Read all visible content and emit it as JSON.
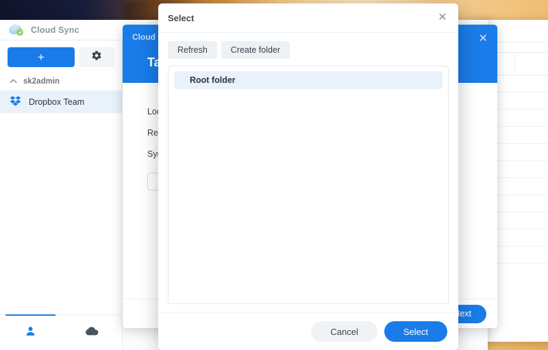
{
  "app": {
    "title": "Cloud Sync",
    "logo_icon": "cloud-sync-logo-icon",
    "sidebar": {
      "add_button_label": "+",
      "add_button_icon": "plus-icon",
      "settings_icon": "gear-icon",
      "group": {
        "label": "sk2admin",
        "collapse_icon": "chevron-up-icon"
      },
      "items": [
        {
          "label": "Dropbox Team",
          "icon": "dropbox-icon"
        }
      ],
      "footer_tabs": [
        {
          "icon": "user-icon",
          "active": true
        },
        {
          "icon": "cloud-icon",
          "active": false
        }
      ]
    }
  },
  "wizard": {
    "window_title": "Cloud Sync",
    "heading": "Task Creation Wizard",
    "close_icon": "close-icon",
    "rows": [
      {
        "label": "Local path:",
        "info_icon": "info-icon"
      },
      {
        "label": "Remote path:",
        "info_icon": "info-icon"
      },
      {
        "label": "Sync direction:",
        "info_icon": ""
      }
    ],
    "footer": {
      "next_label": "Next"
    }
  },
  "bg_window": {
    "restore_icon": "restore-window-icon",
    "close_icon": "close-icon"
  },
  "dialog": {
    "title": "Select",
    "close_icon": "close-icon",
    "toolbar": [
      {
        "label": "Refresh",
        "name": "refresh-button"
      },
      {
        "label": "Create folder",
        "name": "create-folder-button"
      }
    ],
    "list": [
      {
        "label": "Root folder",
        "selected": true
      }
    ],
    "footer": {
      "cancel_label": "Cancel",
      "select_label": "Select"
    }
  },
  "colors": {
    "accent": "#1a7ce8",
    "selection": "#e9f1fb",
    "toolbar_button": "#eef1f4",
    "text": "#2e353b"
  }
}
